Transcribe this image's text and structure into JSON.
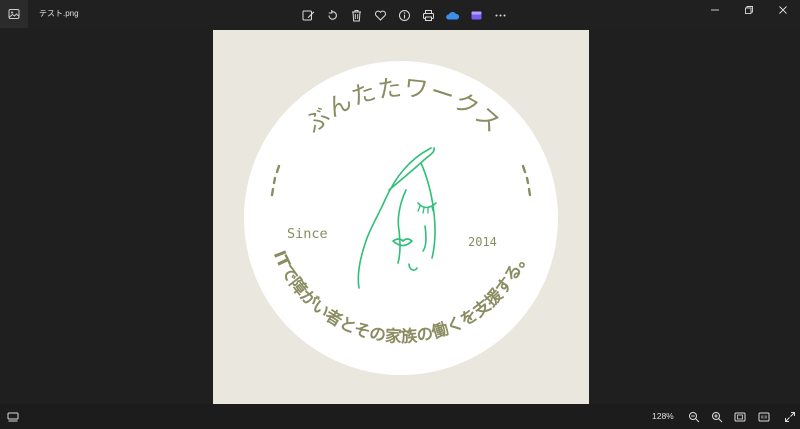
{
  "window": {
    "filename": "テスト.png"
  },
  "toolbar": {
    "icons": [
      "edit-icon",
      "rotate-icon",
      "delete-icon",
      "favorite-icon",
      "info-icon",
      "print-icon",
      "onedrive-icon",
      "clipchamp-icon",
      "more-icon"
    ]
  },
  "image": {
    "brand_name": "ぶんたたワークス",
    "since_label": "Since",
    "year": "2014",
    "tagline": "ITで障がい者とその家族の働くを支援する。",
    "colors": {
      "background": "#e9e7de",
      "circle": "#ffffff",
      "text": "#8a8c61",
      "line_art": "#2fbf78"
    }
  },
  "statusbar": {
    "zoom": "128%"
  }
}
